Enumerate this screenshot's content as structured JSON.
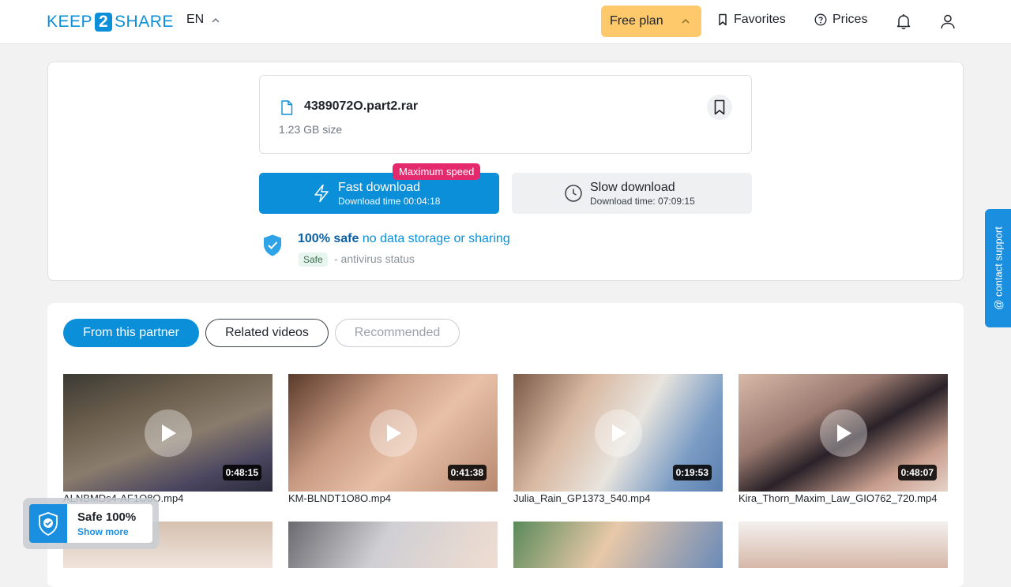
{
  "header": {
    "logo_left": "KEEP",
    "logo_mid": "2",
    "logo_right": "SHARE",
    "language": "EN",
    "plan_label": "Free plan",
    "favorites_label": "Favorites",
    "prices_label": "Prices"
  },
  "file": {
    "name": "4389072O.part2.rar",
    "size": "1.23 GB size"
  },
  "download": {
    "fast_label": "Fast download",
    "fast_time": "Download time 00:04:18",
    "max_badge": "Maximum speed",
    "slow_label": "Slow download",
    "slow_time": "Download time: 07:09:15"
  },
  "safety": {
    "bold": "100% safe",
    "rest": "no data storage or sharing",
    "badge": "Safe",
    "note": "- antivirus status"
  },
  "tabs": [
    "From this partner",
    "Related videos",
    "Recommended"
  ],
  "videos": [
    {
      "title": "ALNBMDs4-AF1O8O.mp4",
      "duration": "0:48:15"
    },
    {
      "title": "KM-BLNDT1O8O.mp4",
      "duration": "0:41:38"
    },
    {
      "title": "Julia_Rain_GP1373_540.mp4",
      "duration": "0:19:53"
    },
    {
      "title": "Kira_Thorn_Maxim_Law_GIO762_720.mp4",
      "duration": "0:48:07"
    }
  ],
  "contact": "@ contact support",
  "safe_widget": {
    "title": "Safe 100%",
    "link": "Show more"
  },
  "colors": {
    "accent": "#0b8fd9",
    "plan": "#fdc96a",
    "badge": "#e42a6d"
  }
}
